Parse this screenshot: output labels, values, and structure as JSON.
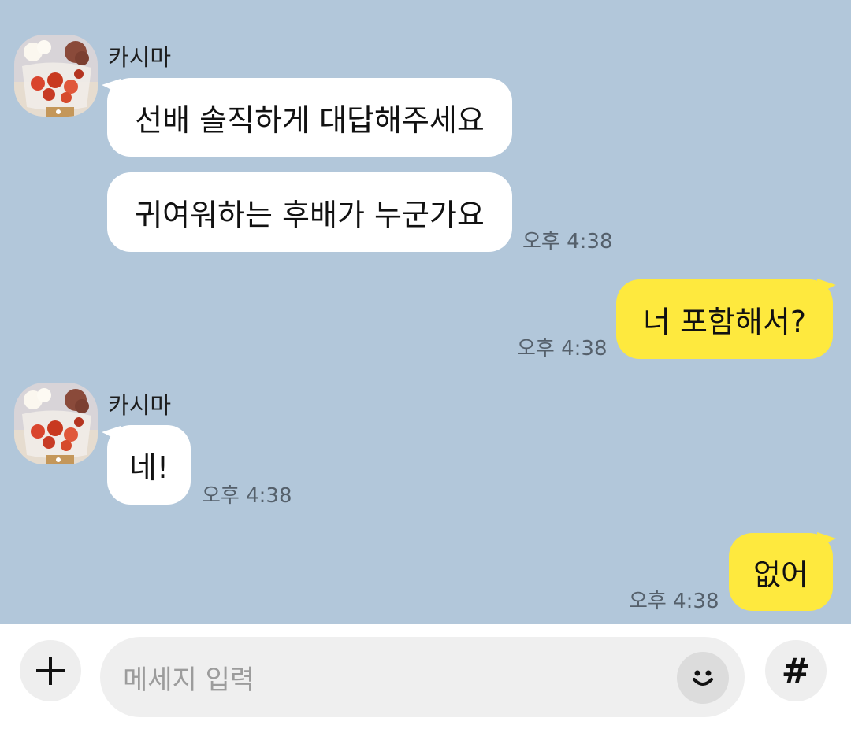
{
  "messages": [
    {
      "direction": "incoming",
      "sender": "카시마",
      "bubbles": [
        "선배 솔직하게 대답해주세요",
        "귀여워하는 후배가 누군가요"
      ],
      "time": "오후 4:38"
    },
    {
      "direction": "outgoing",
      "bubbles": [
        "너 포함해서?"
      ],
      "time": "오후 4:38"
    },
    {
      "direction": "incoming",
      "sender": "카시마",
      "bubbles": [
        "네!"
      ],
      "time": "오후 4:38"
    },
    {
      "direction": "outgoing",
      "bubbles": [
        "없어"
      ],
      "time": "오후 4:38"
    }
  ],
  "input": {
    "placeholder": "메세지 입력",
    "plus_icon": "plus-icon",
    "emoji_icon": "smile-icon",
    "hash_label": "#"
  },
  "colors": {
    "chat_background": "#b2c7da",
    "incoming_bubble": "#ffffff",
    "outgoing_bubble": "#fee93e",
    "input_bar": "#ffffff"
  }
}
